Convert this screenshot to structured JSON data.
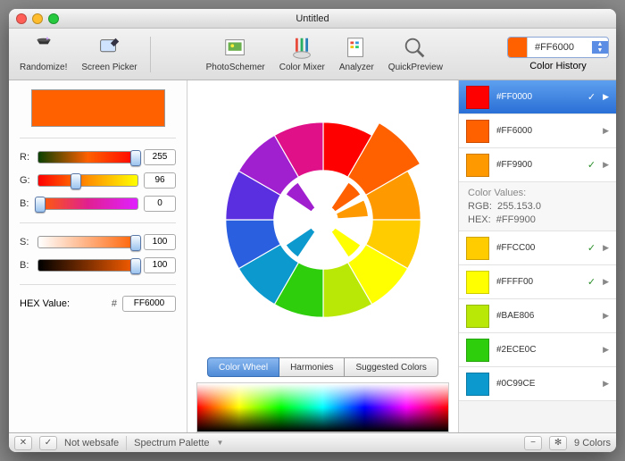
{
  "window": {
    "title": "Untitled"
  },
  "toolbar": {
    "randomize": "Randomize!",
    "screen_picker": "Screen Picker",
    "photo_schemer": "PhotoSchemer",
    "color_mixer": "Color Mixer",
    "analyzer": "Analyzer",
    "quick_preview": "QuickPreview",
    "color_history": "Color History",
    "history_hex": "#FF6000"
  },
  "swatch": {
    "color": "#FF6000"
  },
  "sliders": {
    "r_label": "R:",
    "r_value": "255",
    "g_label": "G:",
    "g_value": "96",
    "b_label": "B:",
    "b_value": "0",
    "s_label": "S:",
    "s_value": "100",
    "br_label": "B:",
    "br_value": "100"
  },
  "hex": {
    "label": "HEX Value:",
    "hash": "#",
    "value": "FF6000"
  },
  "tabs": {
    "wheel": "Color Wheel",
    "harmonies": "Harmonies",
    "suggested": "Suggested Colors"
  },
  "wheel_segments": [
    "#ff0000",
    "#ff6000",
    "#ff9900",
    "#ffcc00",
    "#ffff00",
    "#bae806",
    "#2ece0c",
    "#0c99ce",
    "#2a5fe0",
    "#5a2fe0",
    "#a020d0",
    "#e01088"
  ],
  "swatches": [
    {
      "hex": "#FF0000",
      "check": true,
      "selected": true
    },
    {
      "hex": "#FF6000",
      "check": false,
      "selected": false
    },
    {
      "hex": "#FF9900",
      "check": true,
      "selected": false
    },
    {
      "hex": "#FFCC00",
      "check": true,
      "selected": false
    },
    {
      "hex": "#FFFF00",
      "check": true,
      "selected": false
    },
    {
      "hex": "#BAE806",
      "check": false,
      "selected": false
    },
    {
      "hex": "#2ECE0C",
      "check": false,
      "selected": false
    },
    {
      "hex": "#0C99CE",
      "check": false,
      "selected": false
    }
  ],
  "color_values": {
    "title": "Color Values:",
    "rgb_label": "RGB:",
    "rgb": "255.153.0",
    "hex_label": "HEX:",
    "hex": "#FF9900"
  },
  "status": {
    "websafe": "Not websafe",
    "palette": "Spectrum Palette",
    "count": "9 Colors"
  }
}
